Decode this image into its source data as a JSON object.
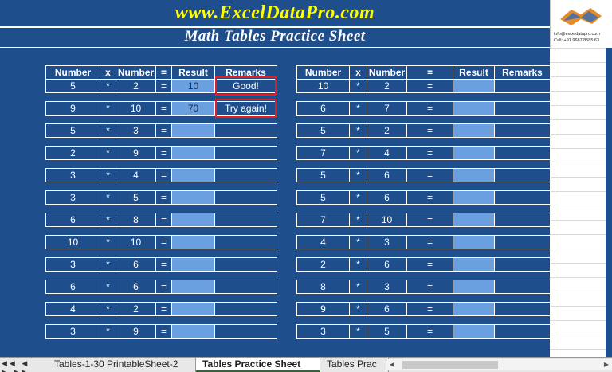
{
  "header": {
    "site": "www.ExcelDataPro.com",
    "title": "Math Tables Practice Sheet"
  },
  "logo": {
    "email": "info@exceldatapro.com",
    "phone": "Call: +91 9687 8585 63"
  },
  "columns": {
    "number1": "Number",
    "x": "x",
    "number2": "Number",
    "eq": "=",
    "result": "Result",
    "remarks": "Remarks"
  },
  "left_rows": [
    {
      "a": "5",
      "op": "*",
      "b": "2",
      "eq": "=",
      "result": "10",
      "remark": "Good!"
    },
    {
      "a": "9",
      "op": "*",
      "b": "10",
      "eq": "=",
      "result": "70",
      "remark": "Try again!"
    },
    {
      "a": "5",
      "op": "*",
      "b": "3",
      "eq": "=",
      "result": "",
      "remark": ""
    },
    {
      "a": "2",
      "op": "*",
      "b": "9",
      "eq": "=",
      "result": "",
      "remark": ""
    },
    {
      "a": "3",
      "op": "*",
      "b": "4",
      "eq": "=",
      "result": "",
      "remark": ""
    },
    {
      "a": "3",
      "op": "*",
      "b": "5",
      "eq": "=",
      "result": "",
      "remark": ""
    },
    {
      "a": "6",
      "op": "*",
      "b": "8",
      "eq": "=",
      "result": "",
      "remark": ""
    },
    {
      "a": "10",
      "op": "*",
      "b": "10",
      "eq": "=",
      "result": "",
      "remark": ""
    },
    {
      "a": "3",
      "op": "*",
      "b": "6",
      "eq": "=",
      "result": "",
      "remark": ""
    },
    {
      "a": "6",
      "op": "*",
      "b": "6",
      "eq": "=",
      "result": "",
      "remark": ""
    },
    {
      "a": "4",
      "op": "*",
      "b": "2",
      "eq": "=",
      "result": "",
      "remark": ""
    },
    {
      "a": "3",
      "op": "*",
      "b": "9",
      "eq": "=",
      "result": "",
      "remark": ""
    }
  ],
  "right_rows": [
    {
      "a": "10",
      "op": "*",
      "b": "2",
      "eq": "=",
      "result": "",
      "remark": ""
    },
    {
      "a": "6",
      "op": "*",
      "b": "7",
      "eq": "=",
      "result": "",
      "remark": ""
    },
    {
      "a": "5",
      "op": "*",
      "b": "2",
      "eq": "=",
      "result": "",
      "remark": ""
    },
    {
      "a": "7",
      "op": "*",
      "b": "4",
      "eq": "=",
      "result": "",
      "remark": ""
    },
    {
      "a": "5",
      "op": "*",
      "b": "6",
      "eq": "=",
      "result": "",
      "remark": ""
    },
    {
      "a": "5",
      "op": "*",
      "b": "6",
      "eq": "=",
      "result": "",
      "remark": ""
    },
    {
      "a": "7",
      "op": "*",
      "b": "10",
      "eq": "=",
      "result": "",
      "remark": ""
    },
    {
      "a": "4",
      "op": "*",
      "b": "3",
      "eq": "=",
      "result": "",
      "remark": ""
    },
    {
      "a": "2",
      "op": "*",
      "b": "6",
      "eq": "=",
      "result": "",
      "remark": ""
    },
    {
      "a": "8",
      "op": "*",
      "b": "3",
      "eq": "=",
      "result": "",
      "remark": ""
    },
    {
      "a": "9",
      "op": "*",
      "b": "6",
      "eq": "=",
      "result": "",
      "remark": ""
    },
    {
      "a": "3",
      "op": "*",
      "b": "5",
      "eq": "=",
      "result": "",
      "remark": ""
    }
  ],
  "tabs": [
    {
      "label": "Tables-1-30 PrintableSheet-2",
      "active": false
    },
    {
      "label": "Tables Practice Sheet",
      "active": true
    },
    {
      "label": "Tables Prac",
      "active": false
    }
  ],
  "icons": {
    "nav": "sheet-navigation-arrows-icon",
    "logo": "handshake-logo-icon"
  },
  "colors": {
    "background": "#1f4e8c",
    "site_title": "#ffff00",
    "result_cell": "#6a9fe0",
    "remark_border": "#e02020"
  }
}
